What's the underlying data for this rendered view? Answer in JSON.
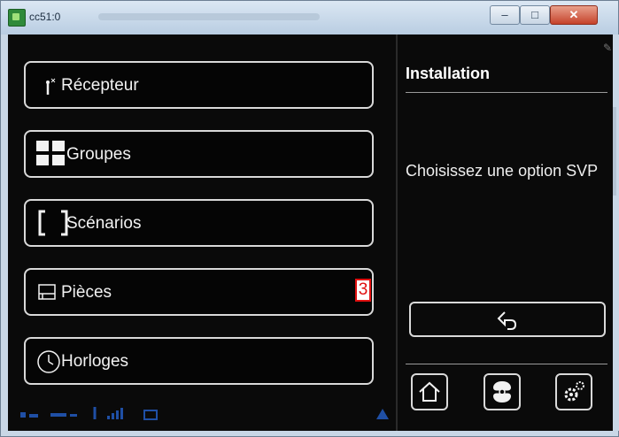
{
  "window": {
    "title": "cc51:0",
    "buttons": {
      "minimize": "–",
      "maximize": "□",
      "close": "✕"
    }
  },
  "menu": [
    {
      "label": "Récepteur",
      "icon": "antenna-icon"
    },
    {
      "label": "Groupes",
      "icon": "groups-grid-icon"
    },
    {
      "label": "Scénarios",
      "icon": "brackets-icon"
    },
    {
      "label": "Pièces",
      "icon": "room-icon"
    },
    {
      "label": "Horloges",
      "icon": "clock-icon"
    }
  ],
  "badge": {
    "value": "3",
    "color": "#e01010"
  },
  "panel": {
    "title": "Installation",
    "message": "Choisissez une option SVP"
  },
  "bottom_buttons": [
    "home-icon",
    "fan-icon",
    "settings-gear-icon"
  ],
  "colors": {
    "screen": "#0a0a0a",
    "text": "#f2f2f2",
    "border": "#d9d9d9",
    "status": "#1f4fa5"
  }
}
